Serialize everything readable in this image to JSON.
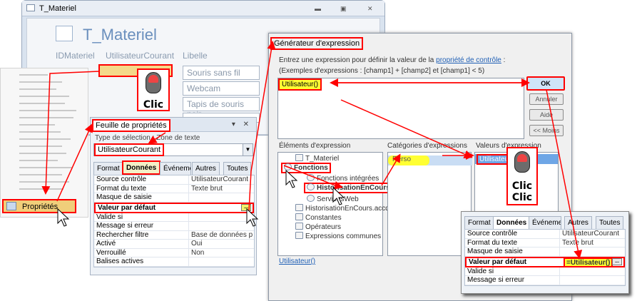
{
  "form": {
    "title_bar": "T_Materiel",
    "title": "T_Materiel",
    "columns": [
      "IDMateriel",
      "UtilisateurCourant",
      "Libelle"
    ],
    "rows": [
      "Souris sans fil",
      "Webcam",
      "Tapis de souris noir"
    ]
  },
  "context_menu": {
    "properties_label": "Propriétés"
  },
  "property_sheet": {
    "title": "Feuille de propriétés",
    "selection_type": "Type de sélection :  Zone de texte",
    "control_name": "UtilisateurCourant",
    "tabs": [
      "Format",
      "Données",
      "Événement",
      "Autres",
      "Toutes"
    ],
    "rows": [
      {
        "label": "Source contrôle",
        "value": "UtilisateurCourant"
      },
      {
        "label": "Format du texte",
        "value": "Texte brut"
      },
      {
        "label": "Masque de saisie",
        "value": ""
      },
      {
        "label": "Valeur par défaut",
        "value": ""
      },
      {
        "label": "Valide si",
        "value": ""
      },
      {
        "label": "Message si erreur",
        "value": ""
      },
      {
        "label": "Rechercher filtre",
        "value": "Base de données p"
      },
      {
        "label": "Activé",
        "value": "Oui"
      },
      {
        "label": "Verrouillé",
        "value": "Non"
      },
      {
        "label": "Balises actives",
        "value": ""
      }
    ],
    "builder_button": "..."
  },
  "expression_builder": {
    "title": "Générateur d'expression",
    "description_prefix": "Entrez une expression pour définir la valeur de la ",
    "description_link": "propriété de contrôle",
    "description_suffix": " :",
    "examples": "(Exemples d'expressions : [champ1] + [champ2] et [champ1] < 5)",
    "expression_value": "Utilisateur()",
    "buttons": {
      "ok": "OK",
      "cancel": "Annuler",
      "help": "Aide",
      "less": "<< Moins"
    },
    "elements_label": "Éléments d'expression",
    "categories_label": "Catégories d'expressions",
    "values_label": "Valeurs d'expression",
    "elements": [
      "T_Materiel",
      "Fonctions",
      "Fonctions intégrées",
      "HistorisationEnCours",
      "ServicesWeb",
      "HistorisationEnCours.accdb",
      "Constantes",
      "Opérateurs",
      "Expressions communes"
    ],
    "category": "Perso",
    "value_selected": "Utilisateur",
    "footer_link": "Utilisateur()"
  },
  "inset_sheet": {
    "tabs": [
      "Format",
      "Données",
      "Événement",
      "Autres",
      "Toutes"
    ],
    "rows": [
      {
        "label": "Source contrôle",
        "value": "UtilisateurCourant"
      },
      {
        "label": "Format du texte",
        "value": "Texte brut"
      },
      {
        "label": "Masque de saisie",
        "value": ""
      },
      {
        "label": "Valeur par défaut",
        "value": "=Utilisateur()"
      },
      {
        "label": "Valide si",
        "value": ""
      },
      {
        "label": "Message si erreur",
        "value": ""
      }
    ],
    "builder_button": "..."
  },
  "badges": {
    "click": "Clic",
    "double_click_1": "Clic",
    "double_click_2": "Clic"
  },
  "colors": {
    "annotation": "#ff0000",
    "highlight": "#ffff33",
    "selection": "#6ea6e6"
  }
}
